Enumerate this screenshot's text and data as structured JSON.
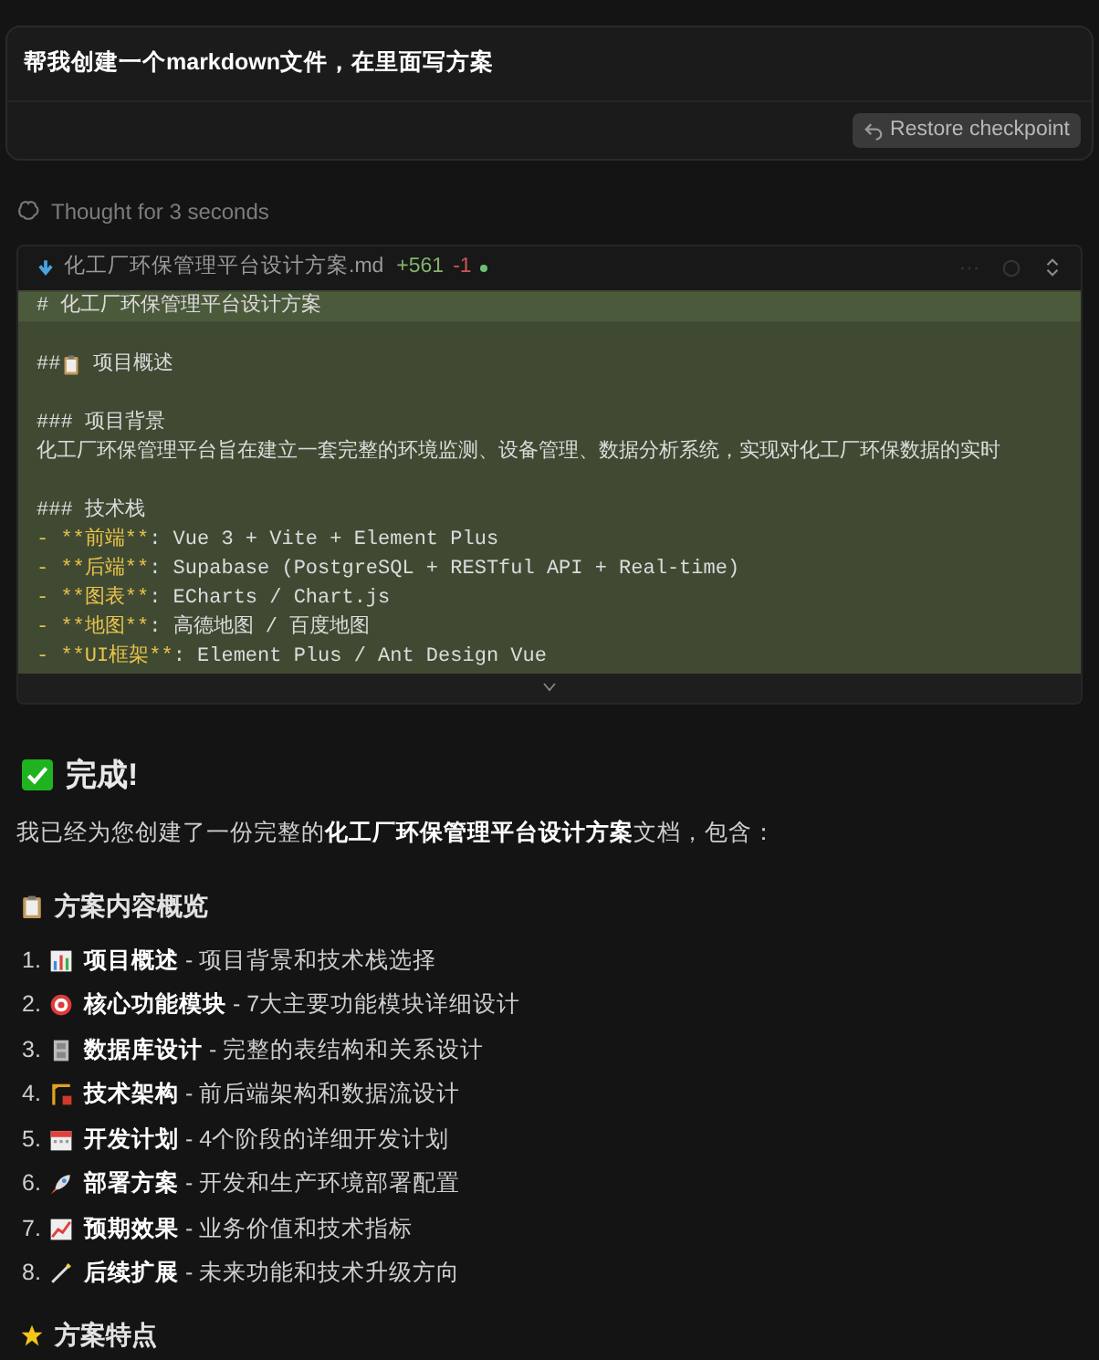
{
  "user_message": {
    "text": "帮我创建一个markdown文件，在里面写方案",
    "button": "Restore checkpoint"
  },
  "thought": "Thought for 3 seconds",
  "file_panel": {
    "filename": "化工厂环保管理平台设计方案.md",
    "added": "+561",
    "removed": "-1",
    "lines": [
      {
        "kind": "h1",
        "text": "# 化工厂环保管理平台设计方案"
      },
      {
        "kind": "blank"
      },
      {
        "kind": "h2",
        "text": "## ",
        "title": "项目概述"
      },
      {
        "kind": "blank"
      },
      {
        "kind": "text",
        "text": "### 项目背景"
      },
      {
        "kind": "text",
        "text": "化工厂环保管理平台旨在建立一套完整的环境监测、设备管理、数据分析系统，实现对化工厂环保数据的实时"
      },
      {
        "kind": "blank"
      },
      {
        "kind": "text",
        "text": "### 技术栈"
      },
      {
        "kind": "bullet",
        "mark": "- **前端**",
        "text": ": Vue 3 + Vite + Element Plus"
      },
      {
        "kind": "bullet",
        "mark": "- **后端**",
        "text": ": Supabase (PostgreSQL + RESTful API + Real-time)"
      },
      {
        "kind": "bullet",
        "mark": "- **图表**",
        "text": ": ECharts / Chart.js"
      },
      {
        "kind": "bullet",
        "mark": "- **地图**",
        "text": ": 高德地图 / 百度地图"
      },
      {
        "kind": "bullet",
        "mark": "- **UI框架**",
        "text": ": Element Plus / Ant Design Vue"
      }
    ]
  },
  "reply": {
    "title": "完成!",
    "intro": "我已经为您创建了一份完整的**化工厂环保管理平台设计方案**文档，包含：",
    "overview_title": "方案内容概览",
    "items": [
      {
        "number": "1.",
        "text": "**项目概述** - 项目背景和技术栈选择"
      },
      {
        "number": "2.",
        "text": "**核心功能模块** - 7大主要功能模块详细设计"
      },
      {
        "number": "3.",
        "text": "**数据库设计** - 完整的表结构和关系设计"
      },
      {
        "number": "4.",
        "text": "**技术架构** - 前后端架构和数据流设计"
      },
      {
        "number": "5.",
        "text": "**开发计划** - 4个阶段的详细开发计划"
      },
      {
        "number": "6.",
        "text": "**部署方案** - 开发和生产环境部署配置"
      },
      {
        "number": "7.",
        "text": "**预期效果** - 业务价值和技术指标"
      },
      {
        "number": "8.",
        "text": "**后续扩展** - 未来功能和技术升级方向"
      }
    ],
    "features_title": "方案特点"
  }
}
